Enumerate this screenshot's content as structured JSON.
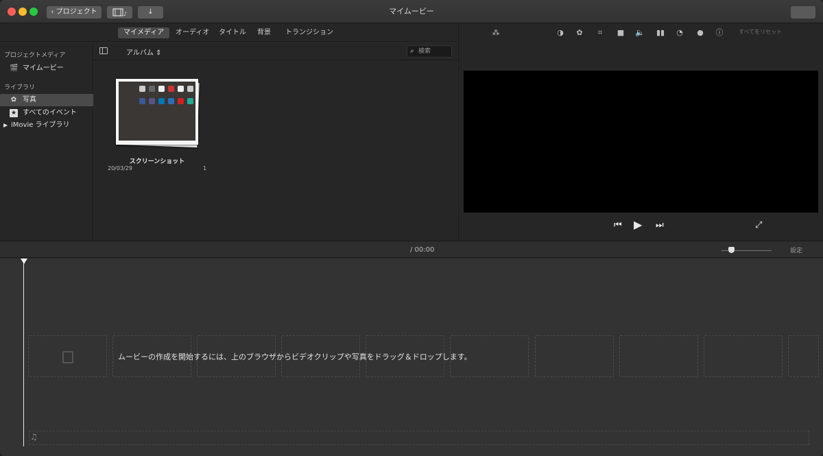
{
  "window": {
    "title": "マイムービー"
  },
  "toolbar": {
    "projects_label": "プロジェクト"
  },
  "tabs": [
    "マイメディア",
    "オーディオ",
    "タイトル",
    "背景",
    "トランジション"
  ],
  "sidebar": {
    "section_project": "プロジェクトメディア",
    "project_item": "マイムービー",
    "section_library": "ライブラリ",
    "photos": "写真",
    "all_events": "すべてのイベント",
    "library": "iMovie ライブラリ"
  },
  "browser": {
    "album_label": "アルバム",
    "search_placeholder": "検索",
    "item": {
      "name": "スクリーンショット",
      "date": "20/03/29",
      "count": "1"
    }
  },
  "viewer": {
    "reset_label": "すべてをリセット",
    "icons": [
      "magic-wand-icon",
      "color-balance-icon",
      "color-correction-icon",
      "crop-icon",
      "stabilization-icon",
      "volume-icon",
      "equalizer-icon",
      "speed-icon",
      "filter-icon",
      "info-icon"
    ]
  },
  "timeline": {
    "time": "/  00:00",
    "settings_label": "設定",
    "hint": "ムービーの作成を開始するには、上のブラウザからビデオクリップや写真をドラッグ＆ドロップします。"
  },
  "colors": {
    "accent": "#4a4a4a",
    "background": "#2b2b2b",
    "timeline": "#333333"
  }
}
